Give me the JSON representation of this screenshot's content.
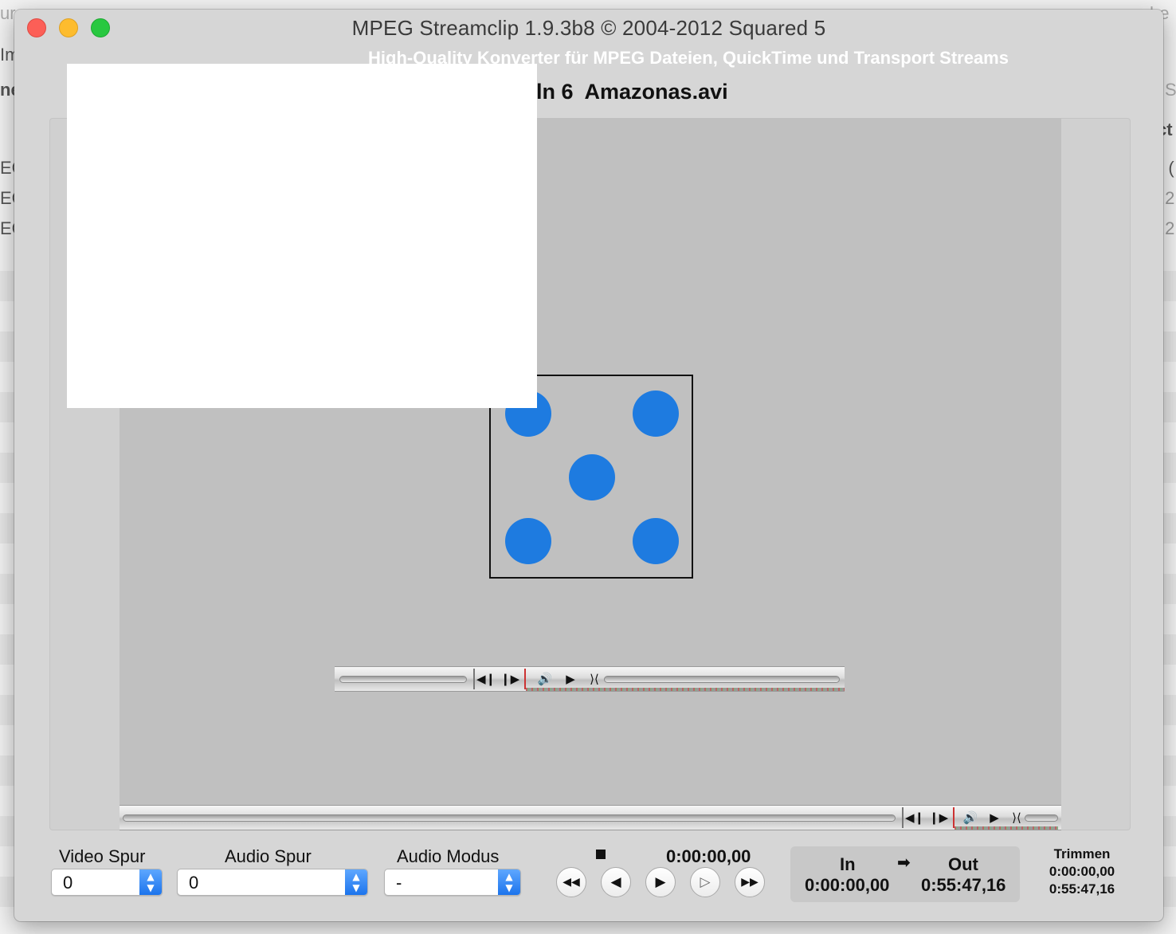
{
  "background": {
    "left_fragments": [
      "ur",
      "Im",
      "ne",
      "EC",
      "EC",
      "EC"
    ],
    "right_fragments": [
      "che",
      "S",
      "ct",
      "e (",
      ".2",
      ".2"
    ]
  },
  "window": {
    "title": "MPEG Streamclip 1.9.3b8  ©  2004-2012 Squared 5",
    "subtitle": "High-Quality Konverter für MPEG Dateien, QuickTime und Transport Streams",
    "file_name": "eln 6  Amazonas.avi"
  },
  "video": {
    "dice_dot_color": "#1e7be0",
    "overlay_color": "#ffffff"
  },
  "inner_player": {
    "buttons": [
      "step-back-icon",
      "step-forward-icon",
      "volume-icon",
      "play-icon"
    ]
  },
  "outer_player": {
    "buttons": [
      "step-back-icon",
      "step-forward-icon",
      "volume-icon",
      "play-icon"
    ]
  },
  "controls": {
    "video_track": {
      "label": "Video Spur",
      "value": "0"
    },
    "audio_track": {
      "label": "Audio Spur",
      "value": "0"
    },
    "audio_mode": {
      "label": "Audio Modus",
      "value": "-"
    },
    "current_time": "0:00:00,00",
    "transport": {
      "stop": "■",
      "rewind": "◀◀",
      "back": "◀",
      "play": "▶",
      "play_outline": "▷",
      "forward": "▶▶"
    },
    "in_label": "In",
    "in_time": "0:00:00,00",
    "arrow": "➡",
    "out_label": "Out",
    "out_time": "0:55:47,16",
    "trim_label": "Trimmen",
    "trim_start": "0:00:00,00",
    "trim_end": "0:55:47,16"
  }
}
